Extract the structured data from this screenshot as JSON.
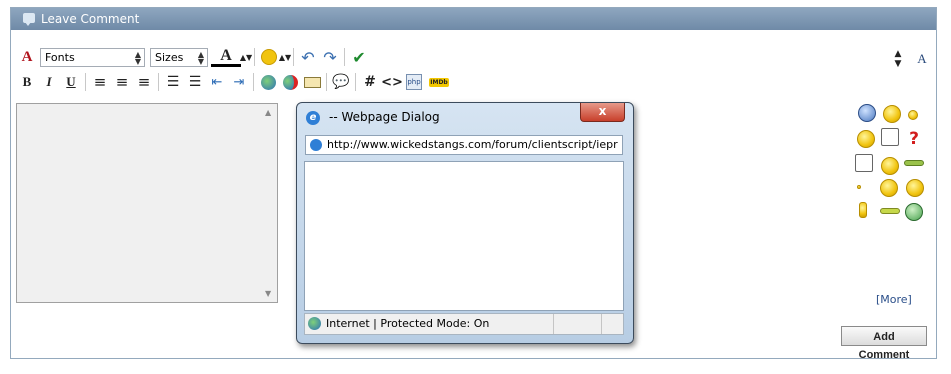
{
  "panel": {
    "title": "Leave Comment"
  },
  "toolbar": {
    "font_select": "Fonts",
    "size_select": "Sizes",
    "bold": "B",
    "italic": "I",
    "underline": "U",
    "hash": "#",
    "code": "<>",
    "php": "php",
    "imdb": "IMDb"
  },
  "dialog": {
    "title": "-- Webpage Dialog",
    "close": "x",
    "address": "http://www.wickedstangs.com/forum/clientscript/iepr",
    "status": "Internet | Protected Mode: On"
  },
  "smilies": {
    "more": "[More]"
  },
  "actions": {
    "add_comment": "Add Comment"
  },
  "colors": {
    "header_bg": "#7b95b0",
    "dialog_frame": "#c6d8ea",
    "close_button": "#c8402b",
    "link": "#2b4f8a"
  }
}
